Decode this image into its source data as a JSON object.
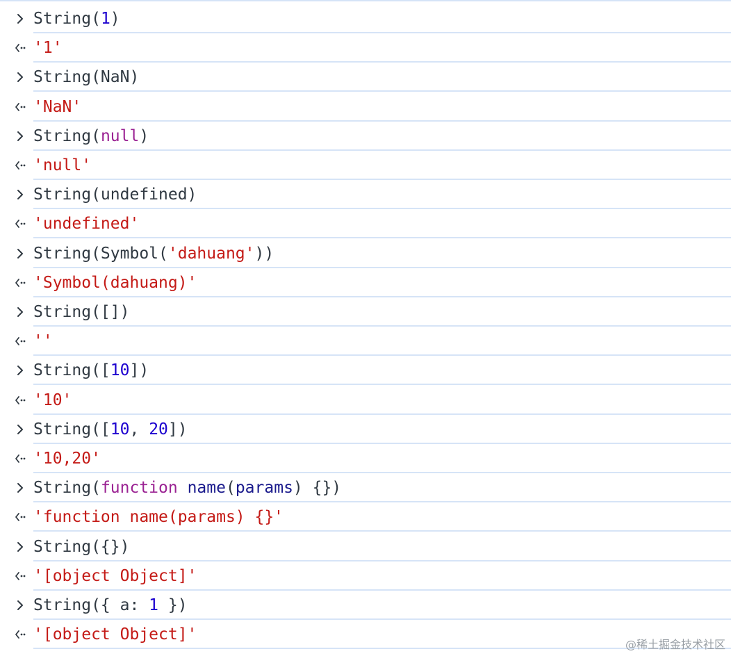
{
  "console": {
    "entries": [
      {
        "kind": "input",
        "tokens": [
          {
            "t": "String(",
            "c": "plain"
          },
          {
            "t": "1",
            "c": "num"
          },
          {
            "t": ")",
            "c": "plain"
          }
        ]
      },
      {
        "kind": "output",
        "tokens": [
          {
            "t": "'1'",
            "c": "result"
          }
        ]
      },
      {
        "kind": "input",
        "tokens": [
          {
            "t": "String(NaN)",
            "c": "plain"
          }
        ]
      },
      {
        "kind": "output",
        "tokens": [
          {
            "t": "'NaN'",
            "c": "result"
          }
        ]
      },
      {
        "kind": "input",
        "tokens": [
          {
            "t": "String(",
            "c": "plain"
          },
          {
            "t": "null",
            "c": "kw"
          },
          {
            "t": ")",
            "c": "plain"
          }
        ]
      },
      {
        "kind": "output",
        "tokens": [
          {
            "t": "'null'",
            "c": "result"
          }
        ]
      },
      {
        "kind": "input",
        "tokens": [
          {
            "t": "String(undefined)",
            "c": "plain"
          }
        ]
      },
      {
        "kind": "output",
        "tokens": [
          {
            "t": "'undefined'",
            "c": "result"
          }
        ]
      },
      {
        "kind": "input",
        "tokens": [
          {
            "t": "String(Symbol(",
            "c": "plain"
          },
          {
            "t": "'dahuang'",
            "c": "str"
          },
          {
            "t": "))",
            "c": "plain"
          }
        ]
      },
      {
        "kind": "output",
        "tokens": [
          {
            "t": "'Symbol(dahuang)'",
            "c": "result"
          }
        ]
      },
      {
        "kind": "input",
        "tokens": [
          {
            "t": "String([])",
            "c": "plain"
          }
        ]
      },
      {
        "kind": "output",
        "tokens": [
          {
            "t": "''",
            "c": "result"
          }
        ]
      },
      {
        "kind": "input",
        "tokens": [
          {
            "t": "String([",
            "c": "plain"
          },
          {
            "t": "10",
            "c": "num"
          },
          {
            "t": "])",
            "c": "plain"
          }
        ]
      },
      {
        "kind": "output",
        "tokens": [
          {
            "t": "'10'",
            "c": "result"
          }
        ]
      },
      {
        "kind": "input",
        "tokens": [
          {
            "t": "String([",
            "c": "plain"
          },
          {
            "t": "10",
            "c": "num"
          },
          {
            "t": ", ",
            "c": "plain"
          },
          {
            "t": "20",
            "c": "num"
          },
          {
            "t": "])",
            "c": "plain"
          }
        ]
      },
      {
        "kind": "output",
        "tokens": [
          {
            "t": "'10,20'",
            "c": "result"
          }
        ]
      },
      {
        "kind": "input",
        "tokens": [
          {
            "t": "String(",
            "c": "plain"
          },
          {
            "t": "function",
            "c": "kw"
          },
          {
            "t": " ",
            "c": "plain"
          },
          {
            "t": "name",
            "c": "name"
          },
          {
            "t": "(",
            "c": "plain"
          },
          {
            "t": "params",
            "c": "name"
          },
          {
            "t": ") {})",
            "c": "plain"
          }
        ]
      },
      {
        "kind": "output",
        "tokens": [
          {
            "t": "'function name(params) {}'",
            "c": "result"
          }
        ]
      },
      {
        "kind": "input",
        "tokens": [
          {
            "t": "String({})",
            "c": "plain"
          }
        ]
      },
      {
        "kind": "output",
        "tokens": [
          {
            "t": "'[object Object]'",
            "c": "result"
          }
        ]
      },
      {
        "kind": "input",
        "tokens": [
          {
            "t": "String({ a: ",
            "c": "plain"
          },
          {
            "t": "1",
            "c": "num"
          },
          {
            "t": " })",
            "c": "plain"
          }
        ]
      },
      {
        "kind": "output",
        "tokens": [
          {
            "t": "'[object Object]'",
            "c": "result"
          }
        ]
      }
    ]
  },
  "icons": {
    "input": "chevron-right-icon",
    "output": "return-arrow-icon"
  },
  "colors": {
    "plain": "#303942",
    "num": "#1c00cf",
    "kw": "#9b2393",
    "str": "#c41a16",
    "name": "#1a1a8c",
    "result": "#c41a16",
    "separator": "#d6e4f7"
  },
  "watermark": "@稀土掘金技术社区"
}
